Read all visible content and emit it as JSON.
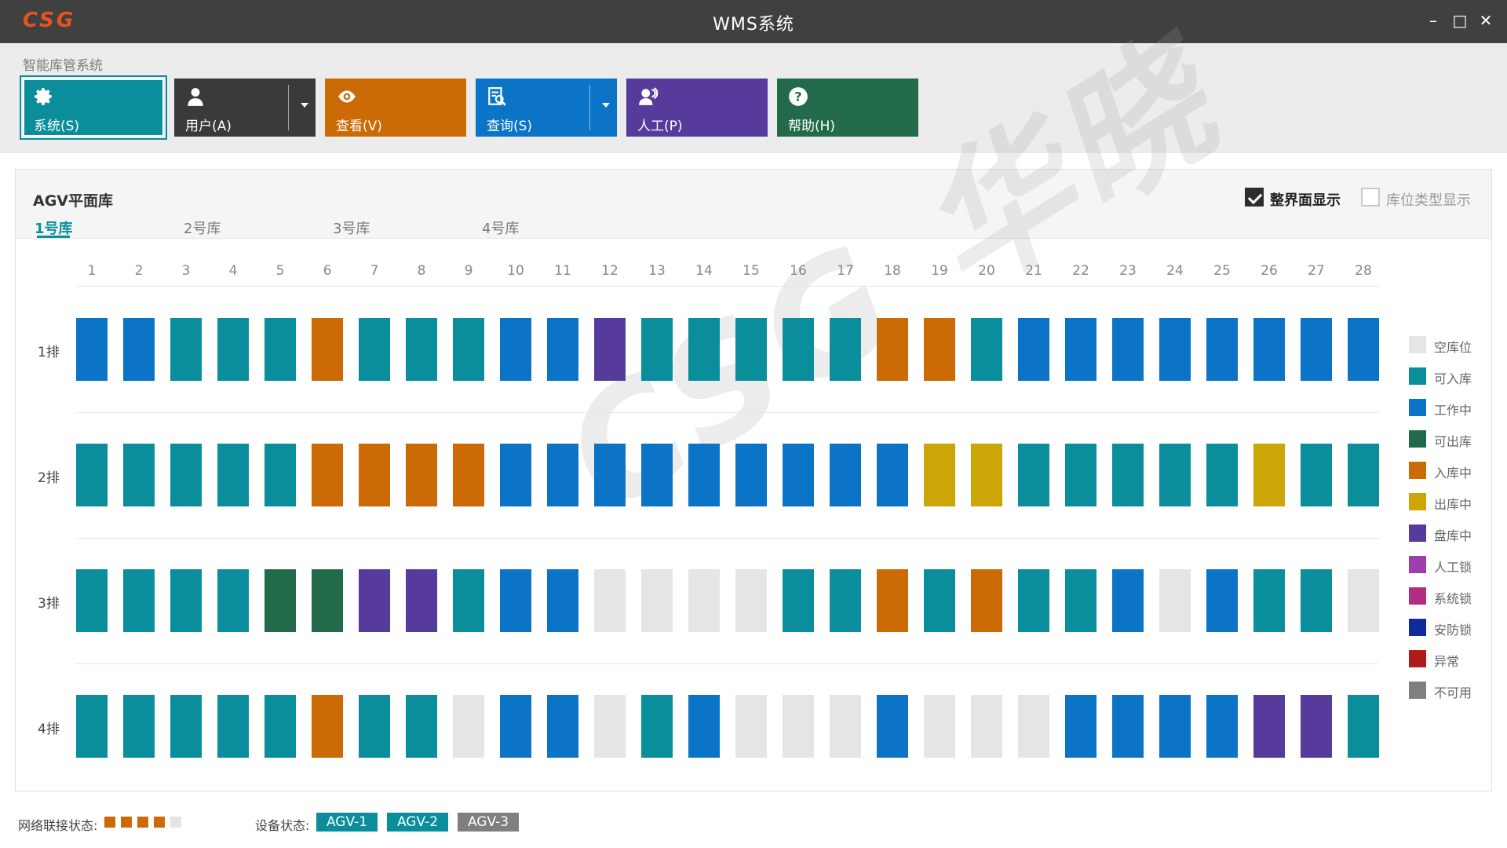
{
  "titlebar": {
    "logo": "CSG",
    "title": "WMS系统",
    "minimize": "–",
    "maximize": "□",
    "close": "✕"
  },
  "ribbon": {
    "group_title": "智能库管系统",
    "buttons": [
      {
        "label": "系统(S)",
        "icon": "gear-icon",
        "color": "#0a8e9c",
        "dropdown": false,
        "selected": true
      },
      {
        "label": "用户(A)",
        "icon": "user-icon",
        "color": "#3a3a3a",
        "dropdown": true,
        "selected": false
      },
      {
        "label": "查看(V)",
        "icon": "eye-icon",
        "color": "#cc6a06",
        "dropdown": false,
        "selected": false
      },
      {
        "label": "查询(S)",
        "icon": "search-doc-icon",
        "color": "#0b74c6",
        "dropdown": true,
        "selected": false
      },
      {
        "label": "人工(P)",
        "icon": "person-icon",
        "color": "#563b9c",
        "dropdown": false,
        "selected": false
      },
      {
        "label": "帮助(H)",
        "icon": "help-icon",
        "color": "#236a4a",
        "dropdown": false,
        "selected": false
      }
    ]
  },
  "panel": {
    "title": "AGV平面库",
    "tabs": [
      "1号库",
      "2号库",
      "3号库",
      "4号库"
    ],
    "active_tab": 0,
    "options": [
      {
        "label": "整界面显示",
        "checked": true
      },
      {
        "label": "库位类型显示",
        "checked": false
      }
    ]
  },
  "grid": {
    "columns": [
      "1",
      "2",
      "3",
      "4",
      "5",
      "6",
      "7",
      "8",
      "9",
      "10",
      "11",
      "12",
      "13",
      "14",
      "15",
      "16",
      "17",
      "18",
      "19",
      "20",
      "21",
      "22",
      "23",
      "24",
      "25",
      "26",
      "27",
      "28"
    ],
    "rows": [
      {
        "label": "1排",
        "cells": [
          "工作中",
          "工作中",
          "可入库",
          "可入库",
          "可入库",
          "入库中",
          "可入库",
          "可入库",
          "可入库",
          "工作中",
          "工作中",
          "盘库中",
          "可入库",
          "可入库",
          "可入库",
          "可入库",
          "可入库",
          "入库中",
          "入库中",
          "可入库",
          "工作中",
          "工作中",
          "工作中",
          "工作中",
          "工作中",
          "工作中",
          "工作中",
          "工作中"
        ]
      },
      {
        "label": "2排",
        "cells": [
          "可入库",
          "可入库",
          "可入库",
          "可入库",
          "可入库",
          "入库中",
          "入库中",
          "入库中",
          "入库中",
          "工作中",
          "工作中",
          "工作中",
          "工作中",
          "工作中",
          "工作中",
          "工作中",
          "工作中",
          "工作中",
          "出库中",
          "出库中",
          "可入库",
          "可入库",
          "可入库",
          "可入库",
          "可入库",
          "出库中",
          "可入库",
          "可入库"
        ]
      },
      {
        "label": "3排",
        "cells": [
          "可入库",
          "可入库",
          "可入库",
          "可入库",
          "可出库",
          "可出库",
          "盘库中",
          "盘库中",
          "可入库",
          "工作中",
          "工作中",
          "空库位",
          "空库位",
          "空库位",
          "空库位",
          "可入库",
          "可入库",
          "入库中",
          "可入库",
          "入库中",
          "可入库",
          "可入库",
          "工作中",
          "空库位",
          "工作中",
          "可入库",
          "可入库",
          "空库位"
        ]
      },
      {
        "label": "4排",
        "cells": [
          "可入库",
          "可入库",
          "可入库",
          "可入库",
          "可入库",
          "入库中",
          "可入库",
          "可入库",
          "空库位",
          "工作中",
          "工作中",
          "空库位",
          "可入库",
          "工作中",
          "空库位",
          "空库位",
          "空库位",
          "工作中",
          "空库位",
          "空库位",
          "空库位",
          "工作中",
          "工作中",
          "工作中",
          "工作中",
          "盘库中",
          "盘库中",
          "可入库"
        ]
      }
    ]
  },
  "legend": [
    {
      "label": "空库位",
      "color": "#e5e5e5"
    },
    {
      "label": "可入库",
      "color": "#0a8e9c"
    },
    {
      "label": "工作中",
      "color": "#0b74c6"
    },
    {
      "label": "可出库",
      "color": "#236a4a"
    },
    {
      "label": "入库中",
      "color": "#cc6a06"
    },
    {
      "label": "出库中",
      "color": "#cca606"
    },
    {
      "label": "盘库中",
      "color": "#563b9c"
    },
    {
      "label": "人工锁",
      "color": "#9c3fad"
    },
    {
      "label": "系统锁",
      "color": "#b02d82"
    },
    {
      "label": "安防锁",
      "color": "#0f2a9c"
    },
    {
      "label": "异常",
      "color": "#b01a1a"
    },
    {
      "label": "不可用",
      "color": "#7f7f7f"
    }
  ],
  "watermark": "CSG 华晓",
  "status": {
    "network_label": "网络联接状态:",
    "network_colors": [
      "#cc6a06",
      "#cc6a06",
      "#cc6a06",
      "#cc6a06",
      "#e5e5e5"
    ],
    "device_label": "设备状态:",
    "devices": [
      {
        "label": "AGV-1",
        "color": "#0a8e9c"
      },
      {
        "label": "AGV-2",
        "color": "#0a8e9c"
      },
      {
        "label": "AGV-3",
        "color": "#7f7f7f"
      }
    ]
  }
}
